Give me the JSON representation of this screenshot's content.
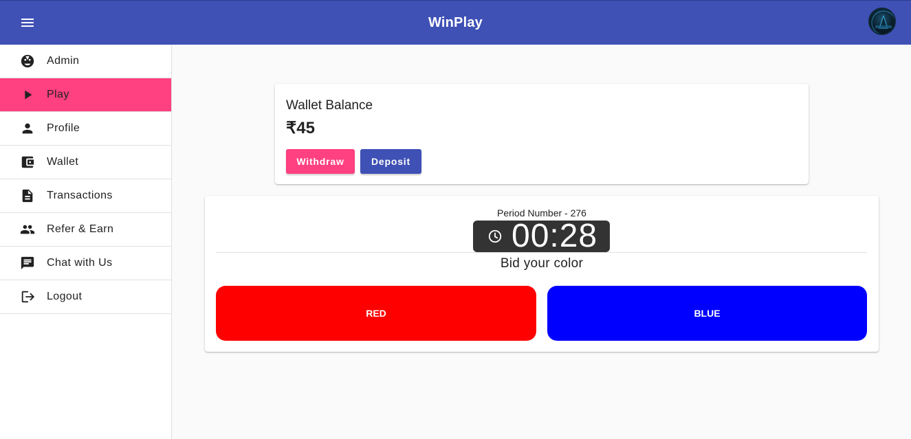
{
  "header": {
    "title": "WinPlay",
    "menu_icon": "hamburger-menu-icon",
    "avatar_icon": "user-avatar"
  },
  "sidebar": {
    "items": [
      {
        "label": "Admin",
        "icon": "admin-face-icon",
        "active": false
      },
      {
        "label": "Play",
        "icon": "play-icon",
        "active": true
      },
      {
        "label": "Profile",
        "icon": "person-icon",
        "active": false
      },
      {
        "label": "Wallet",
        "icon": "wallet-icon",
        "active": false
      },
      {
        "label": "Transactions",
        "icon": "document-icon",
        "active": false
      },
      {
        "label": "Refer & Earn",
        "icon": "people-icon",
        "active": false
      },
      {
        "label": "Chat with Us",
        "icon": "chat-icon",
        "active": false
      },
      {
        "label": "Logout",
        "icon": "logout-icon",
        "active": false
      }
    ]
  },
  "wallet": {
    "title": "Wallet Balance",
    "amount": "₹45",
    "withdraw_label": "Withdraw",
    "deposit_label": "Deposit"
  },
  "game": {
    "period": "Period Number - 276",
    "timer": "00:28",
    "timer_icon": "clock-icon",
    "bid_label": "Bid your color",
    "red_label": "RED",
    "blue_label": "BLUE"
  },
  "colors": {
    "primary": "#3f51b5",
    "accent": "#ff4081",
    "red": "#ff0000",
    "blue": "#0000ff",
    "timer_bg": "#333333"
  }
}
